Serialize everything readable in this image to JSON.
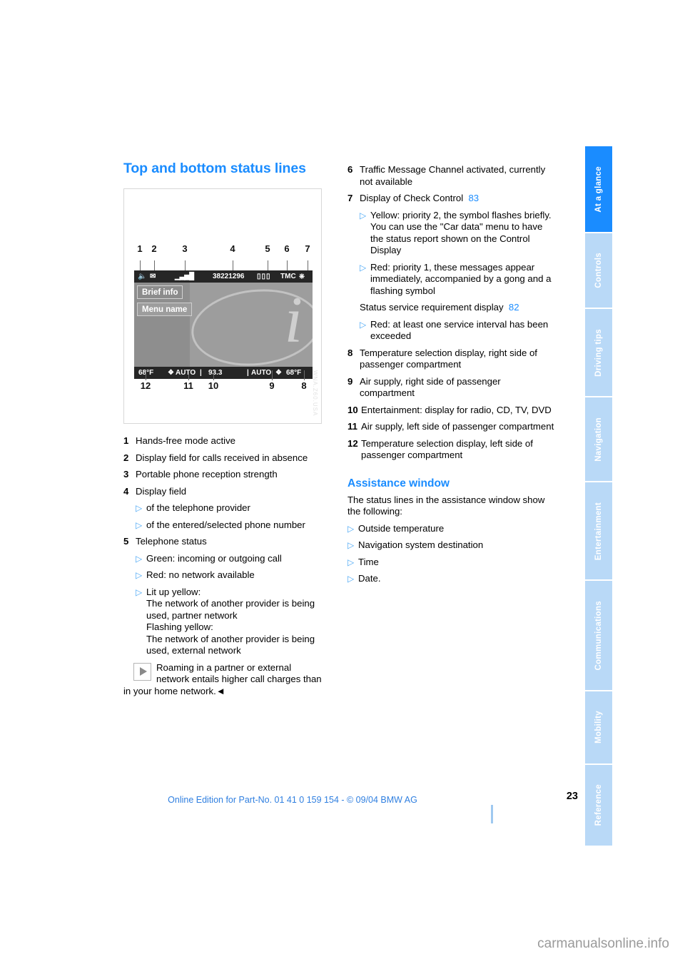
{
  "section": {
    "title": "Top and bottom status lines",
    "subtitle": "Assistance window",
    "assistance_intro": "The status lines in the assistance window show the following:"
  },
  "figure": {
    "code": "WNA.Z60.USA",
    "top_callouts": [
      "1",
      "2",
      "3",
      "4",
      "5",
      "6",
      "7"
    ],
    "bottom_callouts": [
      "12",
      "11",
      "10",
      "9",
      "8"
    ],
    "screen": {
      "phone_number": "38221296",
      "tmc_label": "TMC",
      "brief_info": "Brief info",
      "menu_name": "Menu name",
      "temp_left": "68°F",
      "auto_left": "AUTO",
      "frequency": "93.3",
      "auto_right": "AUTO",
      "temp_right": "68°F",
      "sep_left": "|",
      "sep_right": "|",
      "i_glyph": "i"
    }
  },
  "left_items": [
    {
      "num": "1",
      "text": "Hands-free mode active",
      "subs": []
    },
    {
      "num": "2",
      "text": "Display field for calls received in absence",
      "subs": []
    },
    {
      "num": "3",
      "text": "Portable phone reception strength",
      "subs": []
    },
    {
      "num": "4",
      "text": "Display field",
      "subs": [
        "of the telephone provider",
        "of the entered/selected phone number"
      ]
    },
    {
      "num": "5",
      "text": "Telephone status",
      "subs": [
        "Green: incoming or outgoing call",
        "Red: no network available",
        "Lit up yellow:\nThe network of another provider is being used, partner network\nFlashing yellow:\nThe network of another provider is being used, external network"
      ]
    }
  ],
  "note": {
    "text": "Roaming in a partner or external network entails higher call charges than in your home network.",
    "endmark": "◄",
    "icon": "triangle-right-icon"
  },
  "right_items": [
    {
      "num": "6",
      "text": "Traffic Message Channel activated, currently not available",
      "subs": []
    },
    {
      "num": "7",
      "text": "Display of Check Control",
      "page_ref": "83",
      "subs": [
        "Yellow: priority 2, the symbol flashes briefly. You can use the \"Car data\" menu to have the status report shown on the Control Display",
        "Red: priority 1, these messages appear immediately, accompanied by a gong and a flashing symbol"
      ],
      "trailing_plain": {
        "text": "Status service requirement display",
        "page_ref": "82",
        "subs": [
          "Red: at least one service interval has been exceeded"
        ]
      }
    },
    {
      "num": "8",
      "text": "Temperature selection display, right side of passenger compartment",
      "subs": []
    },
    {
      "num": "9",
      "text": "Air supply, right side of passenger compartment",
      "subs": []
    },
    {
      "num": "10",
      "text": "Entertainment: display for radio, CD, TV, DVD",
      "subs": []
    },
    {
      "num": "11",
      "text": "Air supply, left side of passenger compartment",
      "subs": []
    },
    {
      "num": "12",
      "text": "Temperature selection display, left side of passenger compartment",
      "subs": []
    }
  ],
  "assistance_bullets": [
    "Outside temperature",
    "Navigation system destination",
    "Time",
    "Date."
  ],
  "sidebar": {
    "tabs": [
      {
        "label": "At a glance",
        "active": true
      },
      {
        "label": "Controls",
        "active": false
      },
      {
        "label": "Driving tips",
        "active": false
      },
      {
        "label": "Navigation",
        "active": false
      },
      {
        "label": "Entertainment",
        "active": false
      },
      {
        "label": "Communications",
        "active": false
      },
      {
        "label": "Mobility",
        "active": false
      },
      {
        "label": "Reference",
        "active": false
      }
    ]
  },
  "footer": {
    "page_number": "23",
    "edition_line": "Online Edition for Part-No. 01 41 0 159 154 - © 09/04 BMW AG",
    "watermark": "carmanualsonline.info"
  },
  "colors": {
    "accent_blue": "#1a8cff",
    "tab_inactive": "#b9d9f7",
    "bullet_blue": "#49a7f5",
    "footer_blue": "#2f7fe0"
  }
}
